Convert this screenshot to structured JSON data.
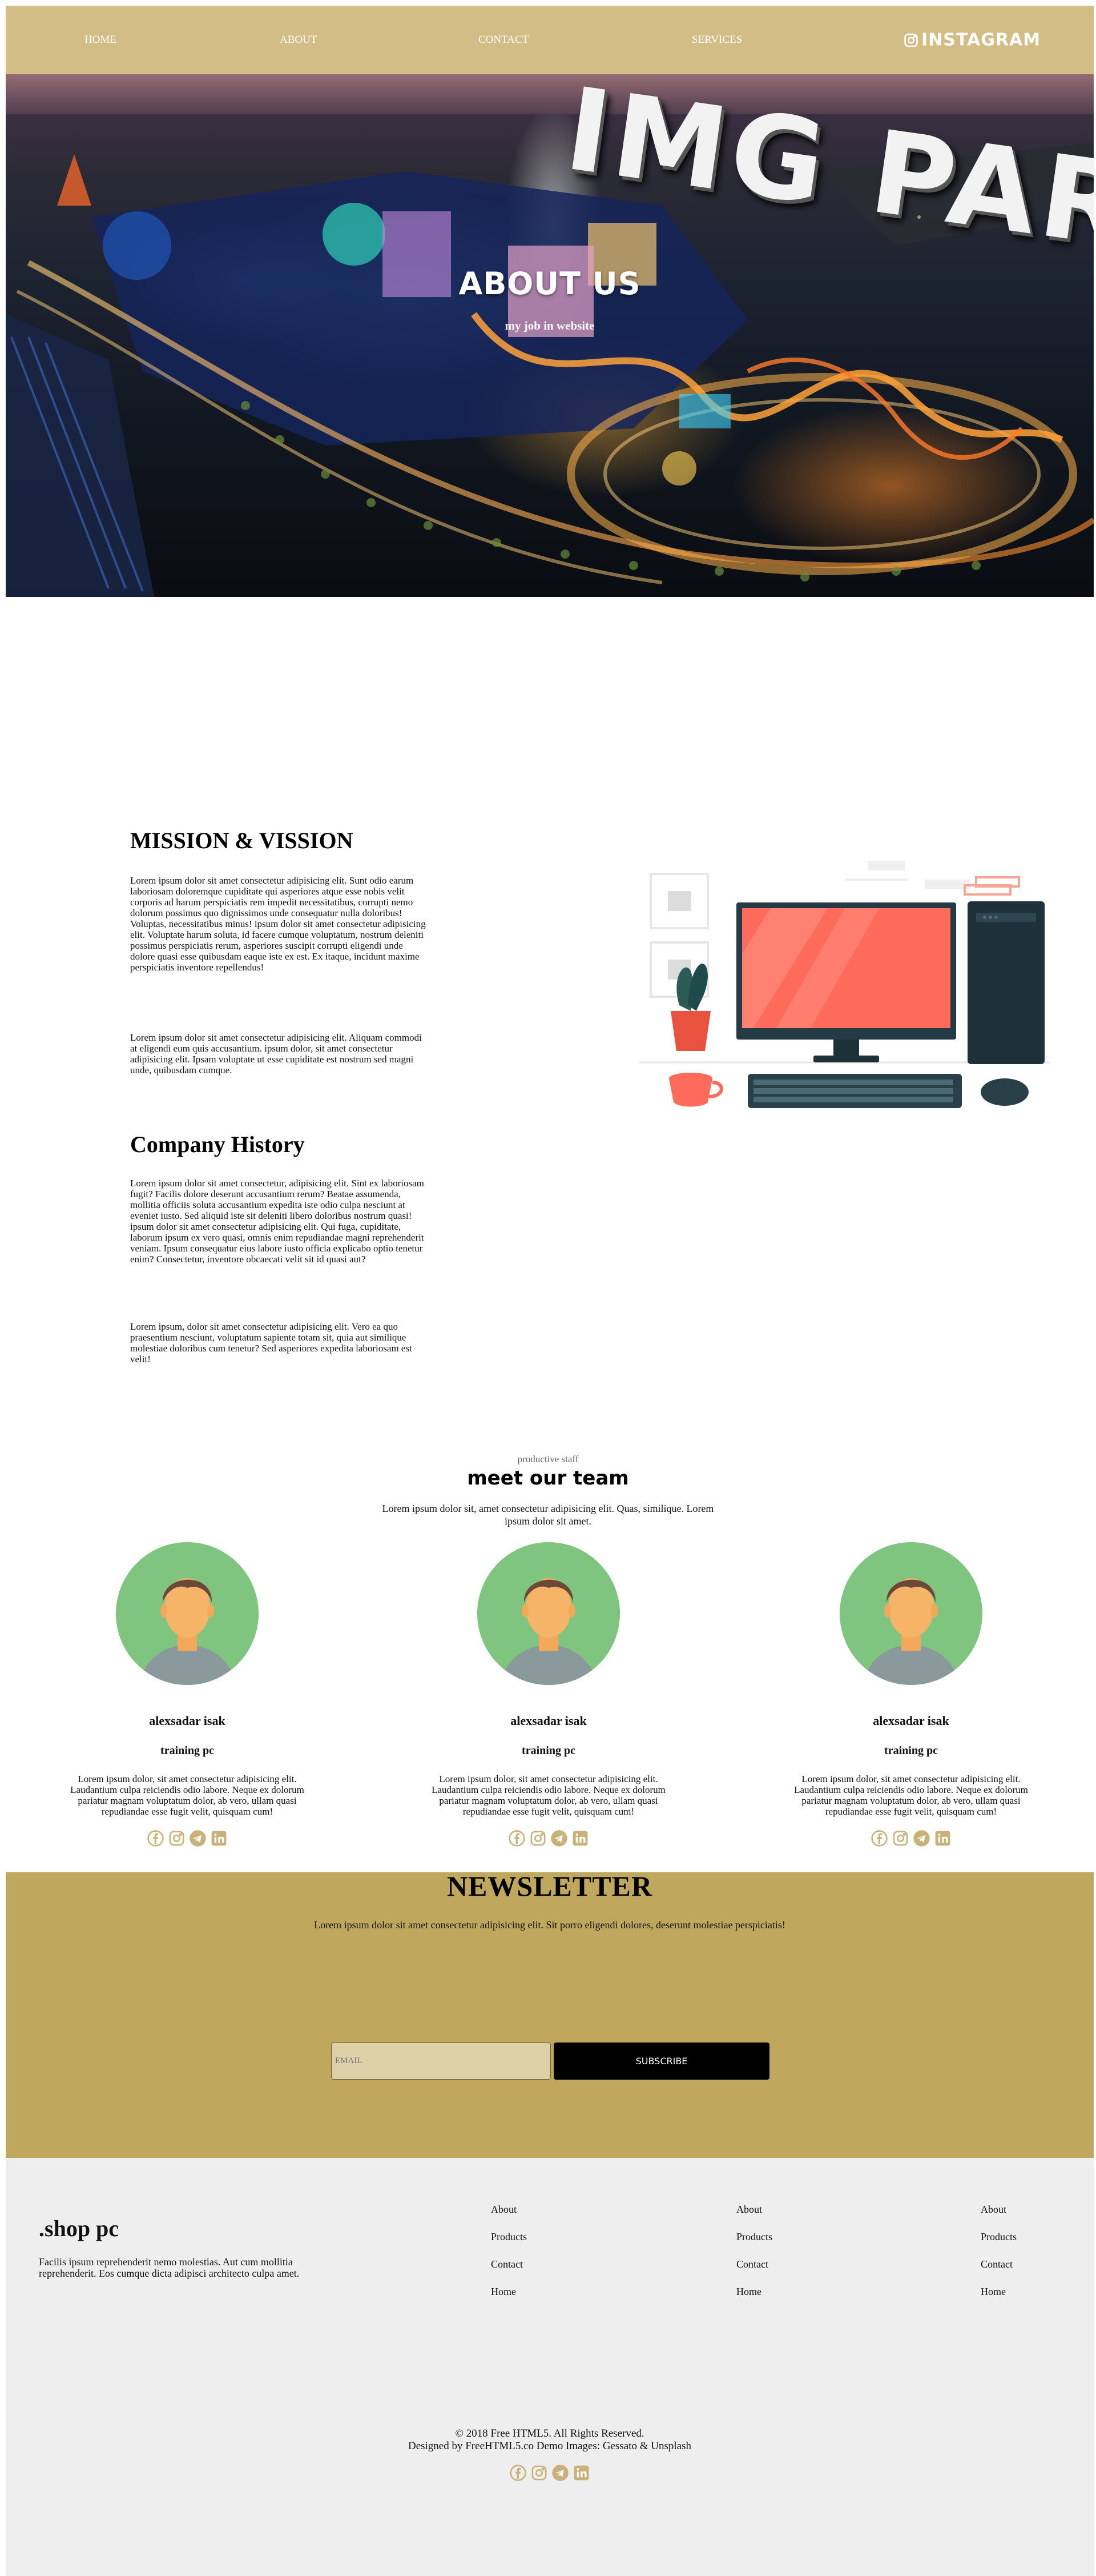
{
  "top": {
    "title": "shop pc."
  },
  "nav": {
    "items": [
      "HOME",
      "ABOUT",
      "CONTACT",
      "SERVICES"
    ],
    "instagram": "INSTAGRAM"
  },
  "hero": {
    "image_text": "IMG PARK",
    "title": "ABOUT US",
    "subtitle": "my job in website"
  },
  "mission": {
    "title": "MISSION & VISSION",
    "p1": "Lorem ipsum dolor sit amet consectetur adipisicing elit. Sunt odio earum laboriosam doloremque cupiditate qui asperiores atque esse nobis velit corporis ad harum perspiciatis rem impedit necessitatibus, corrupti nemo dolorum possimus quo dignissimos unde consequatur nulla doloribus! Voluptas, necessitatibus minus! ipsum dolor sit amet consectetur adipisicing elit. Voluptate harum soluta, id facere cumque voluptatum, nostrum deleniti possimus perspiciatis rerum, asperiores suscipit corrupti eligendi unde dolore quasi esse quibusdam eaque iste ex est. Ex itaque, incidunt maxime perspiciatis inventore repellendus!",
    "p2": "Lorem ipsum dolor sit amet consectetur adipisicing elit. Aliquam commodi at eligendi eum quis accusantium. ipsum dolor, sit amet consectetur adipisicing elit. Ipsam voluptate ut esse cupiditate est nostrum sed magni unde, quibusdam cumque."
  },
  "history": {
    "title": "Company History",
    "p1": "Lorem ipsum dolor sit amet consectetur, adipisicing elit. Sint ex laboriosam fugit? Facilis dolore deserunt accusantium rerum? Beatae assumenda, mollitia officiis soluta accusantium expedita iste odio culpa nesciunt at eveniet iusto. Sed aliquid iste sit deleniti libero doloribus nostrum quasi! ipsum dolor sit amet consectetur adipisicing elit. Qui fuga, cupiditate, laborum ipsum ex vero quasi, omnis enim repudiandae magni reprehenderit veniam. Ipsum consequatur eius labore iusto officia explicabo optio tenetur enim? Consectetur, inventore obcaecati velit sit id quasi aut?",
    "p2": "Lorem ipsum, dolor sit amet consectetur adipisicing elit. Vero ea quo praesentium nesciunt, voluptatum sapiente totam sit, quia aut similique molestiae doloribus cum tenetur? Sed asperiores expedita laboriosam est velit!"
  },
  "team": {
    "kicker": "productive staff",
    "title": "meet our team",
    "intro": "Lorem ipsum dolor sit, amet consectetur adipisicing elit. Quas, similique. Lorem ipsum dolor sit amet.",
    "members": [
      {
        "name": "alexsadar isak",
        "role": "training pc",
        "bio": "Lorem ipsum dolor, sit amet consectetur adipisicing elit. Laudantium culpa reiciendis odio labore. Neque ex dolorum pariatur magnam voluptatum dolor, ab vero, ullam quasi repudiandae esse fugit velit, quisquam cum!"
      },
      {
        "name": "alexsadar isak",
        "role": "training pc",
        "bio": "Lorem ipsum dolor, sit amet consectetur adipisicing elit. Laudantium culpa reiciendis odio labore. Neque ex dolorum pariatur magnam voluptatum dolor, ab vero, ullam quasi repudiandae esse fugit velit, quisquam cum!"
      },
      {
        "name": "alexsadar isak",
        "role": "training pc",
        "bio": "Lorem ipsum dolor, sit amet consectetur adipisicing elit. Laudantium culpa reiciendis odio labore. Neque ex dolorum pariatur magnam voluptatum dolor, ab vero, ullam quasi repudiandae esse fugit velit, quisquam cum!"
      }
    ]
  },
  "newsletter": {
    "title": "NEWSLETTER",
    "text": "Lorem ipsum dolor sit amet consectetur adipisicing elit. Sit porro eligendi dolores, deserunt molestiae perspiciatis!",
    "email_placeholder": "EMAIL",
    "button": "SUBSCRIBE"
  },
  "footer": {
    "brand": ".shop pc",
    "text": "Facilis ipsum reprehenderit nemo molestias. Aut cum mollitia reprehenderit. Eos cumque dicta adipisci architecto culpa amet.",
    "columns": [
      [
        "About",
        "Products",
        "Contact",
        "Home"
      ],
      [
        "About",
        "Products",
        "Contact",
        "Home"
      ],
      [
        "About",
        "Products",
        "Contact",
        "Home"
      ]
    ],
    "copyright": "© 2018 Free HTML5. All Rights Reserved.",
    "credits": "Designed by FreeHTML5.co Demo Images: Gessato & Unsplash"
  },
  "colors": {
    "nav_bg": "#d1bd85",
    "newsletter_bg": "#bfa75e",
    "social_icon": "#c9b27a",
    "avatar_bg": "#7fc47f",
    "footer_bg": "#eeeeee"
  },
  "icons": [
    "instagram-icon",
    "facebook-icon",
    "telegram-icon",
    "linkedin-icon"
  ]
}
